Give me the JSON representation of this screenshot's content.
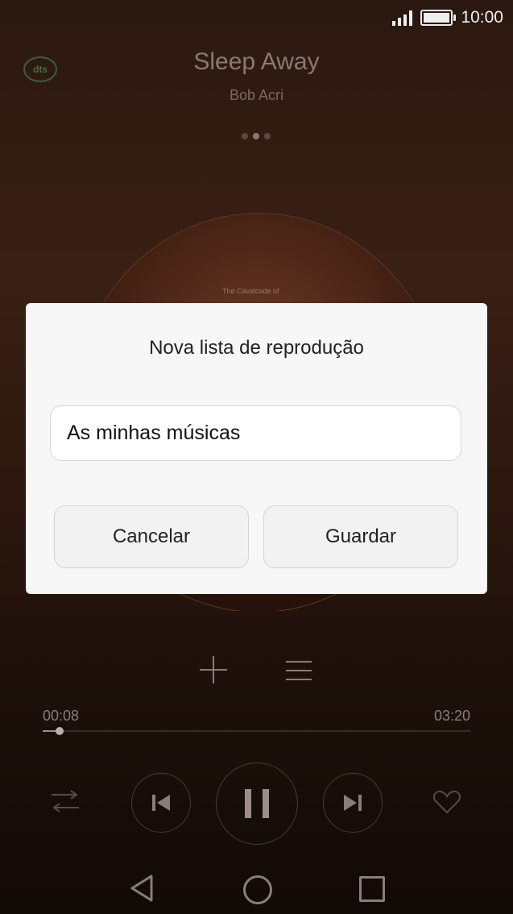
{
  "status_bar": {
    "time": "10:00"
  },
  "player": {
    "dts_label": "dts",
    "song_title": "Sleep Away",
    "artist": "Bob Acri",
    "album_cover_text": "The Cavalcade of",
    "elapsed": "00:08",
    "duration": "03:20",
    "progress_fraction": 0.04
  },
  "dialog": {
    "title": "Nova lista de reprodução",
    "input_value": "As minhas músicas",
    "cancel_label": "Cancelar",
    "save_label": "Guardar"
  },
  "icons": {
    "add": "plus-icon",
    "list": "menu-icon",
    "shuffle": "shuffle-icon",
    "previous": "skip-previous-icon",
    "pause": "pause-icon",
    "next": "skip-next-icon",
    "favorite": "heart-icon",
    "back": "back-icon",
    "home": "home-icon",
    "recent": "recent-apps-icon"
  },
  "colors": {
    "dialog_bg": "#f7f7f7",
    "background": "#2a1810"
  }
}
